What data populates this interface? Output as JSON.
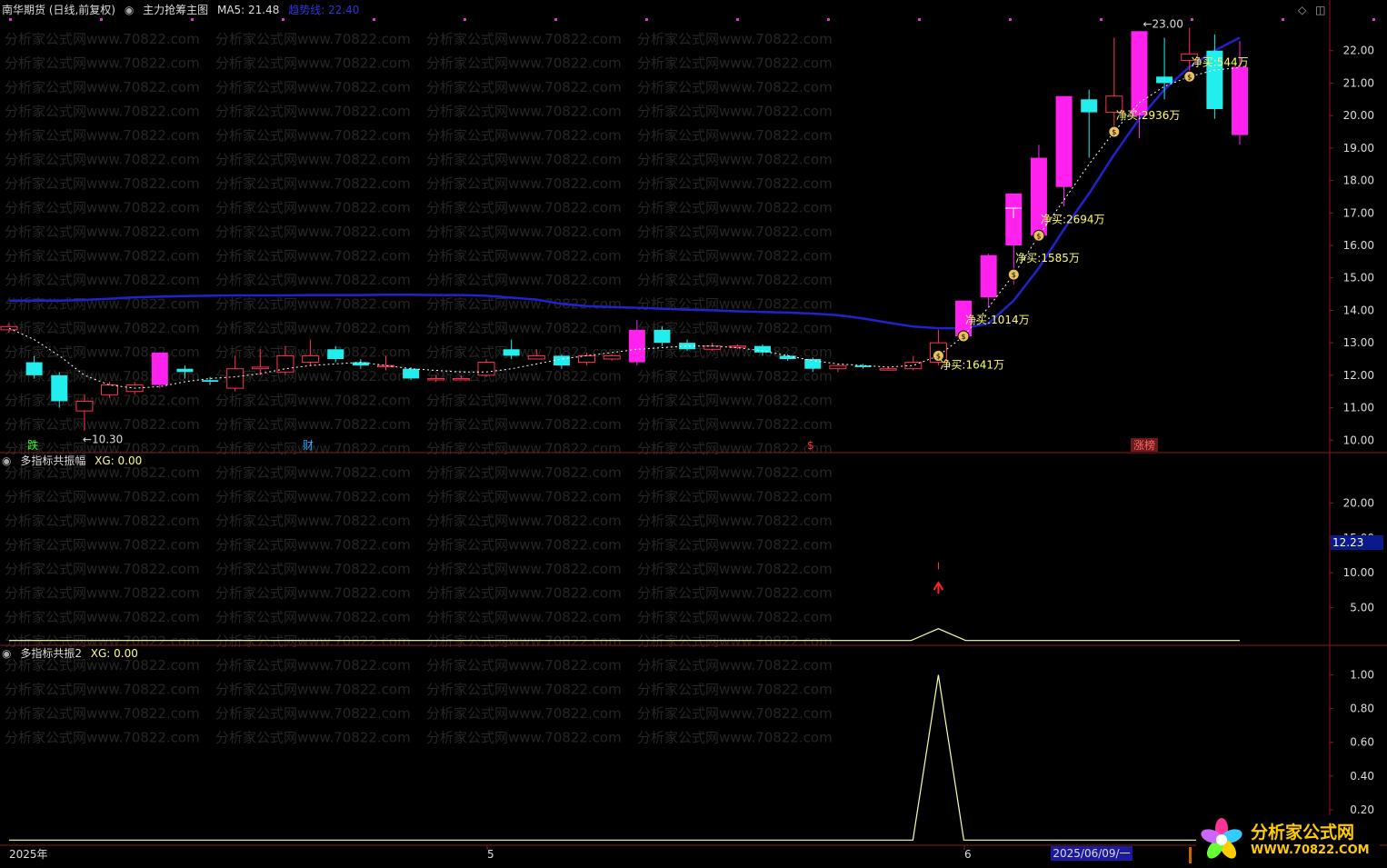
{
  "header1": {
    "symbol": "南华期货 (日线,前复权)",
    "indicator": "主力抢筹主图",
    "ma5_label": "MA5: 21.48",
    "trend_label": "趋势线: 22.40"
  },
  "header2": {
    "name": "多指标共振幅",
    "xg": "XG: 0.00"
  },
  "header3": {
    "name": "多指标共振2",
    "xg": "XG: 0.00"
  },
  "price_axis": [
    "22.00",
    "21.00",
    "20.00",
    "19.00",
    "18.00",
    "17.00",
    "16.00",
    "15.00",
    "14.00",
    "13.00",
    "12.00",
    "11.00",
    "10.00"
  ],
  "axis2": [
    "20.00",
    "15.00",
    "10.00",
    "5.00"
  ],
  "axis3": [
    "1.00",
    "0.80",
    "0.60",
    "0.40",
    "0.20"
  ],
  "axis2_value": "12.23",
  "date_axis": {
    "start": "2025年",
    "m5": "5",
    "m6": "6",
    "cursor": "2025/06/09/一"
  },
  "markers": {
    "m1": "跌",
    "m2": "财",
    "m3": "$",
    "m4": "涨榜"
  },
  "annotations": {
    "high": "23.00",
    "low": "←10.30",
    "buys": [
      "净买:1641万",
      "净买:1014万",
      "净买:1585万",
      "净买:2694万",
      "净买:2936万",
      "净买:544万"
    ]
  },
  "watermark": "分析家公式网www.70822.com",
  "logo": {
    "line1": "分析家公式网",
    "line2": "WWW.70822.COM"
  },
  "chart_data": {
    "type": "candlestick",
    "colors": {
      "up": "#ff3355",
      "down": "#22eeee",
      "strong_up": "#ff22ee",
      "ma": "#2222cc",
      "trend_dots": "#ffffff",
      "osc": "#ffffaa"
    },
    "candles": [
      [
        13.4,
        13.5,
        13.6,
        13.3
      ],
      [
        12.4,
        12.0,
        12.6,
        11.9
      ],
      [
        12.0,
        11.2,
        12.1,
        11.0
      ],
      [
        10.9,
        11.2,
        11.4,
        10.3
      ],
      [
        11.4,
        11.7,
        11.8,
        11.3
      ],
      [
        11.5,
        11.7,
        11.8,
        11.4
      ],
      [
        11.7,
        12.7,
        12.7,
        11.6
      ],
      [
        12.2,
        12.1,
        12.3,
        11.9
      ],
      [
        11.85,
        11.8,
        11.95,
        11.7
      ],
      [
        11.6,
        12.2,
        12.6,
        11.5
      ],
      [
        12.2,
        12.25,
        12.8,
        12.0
      ],
      [
        12.1,
        12.6,
        12.9,
        12.0
      ],
      [
        12.4,
        12.6,
        13.1,
        12.3
      ],
      [
        12.8,
        12.5,
        12.9,
        12.4
      ],
      [
        12.4,
        12.3,
        12.5,
        12.2
      ],
      [
        12.3,
        12.3,
        12.6,
        12.15
      ],
      [
        12.2,
        11.9,
        12.25,
        11.85
      ],
      [
        11.9,
        11.9,
        12.0,
        11.8
      ],
      [
        11.9,
        11.9,
        12.0,
        11.85
      ],
      [
        12.0,
        12.4,
        12.5,
        11.95
      ],
      [
        12.8,
        12.6,
        13.1,
        12.5
      ],
      [
        12.5,
        12.6,
        12.8,
        12.5
      ],
      [
        12.6,
        12.3,
        12.65,
        12.2
      ],
      [
        12.4,
        12.6,
        12.7,
        12.3
      ],
      [
        12.5,
        12.6,
        12.65,
        12.45
      ],
      [
        12.4,
        13.4,
        13.7,
        12.3
      ],
      [
        13.4,
        13.0,
        13.5,
        12.9
      ],
      [
        13.0,
        12.8,
        13.1,
        12.75
      ],
      [
        12.8,
        12.9,
        13.0,
        12.75
      ],
      [
        12.9,
        12.9,
        12.95,
        12.8
      ],
      [
        12.9,
        12.7,
        12.95,
        12.6
      ],
      [
        12.6,
        12.5,
        12.65,
        12.45
      ],
      [
        12.5,
        12.2,
        12.55,
        12.1
      ],
      [
        12.2,
        12.3,
        12.35,
        12.1
      ],
      [
        12.3,
        12.25,
        12.35,
        12.2
      ],
      [
        12.2,
        12.2,
        12.25,
        12.15
      ],
      [
        12.2,
        12.4,
        12.6,
        12.15
      ],
      [
        12.4,
        13.0,
        13.4,
        12.3
      ],
      [
        13.2,
        14.3,
        14.3,
        13.1
      ],
      [
        14.4,
        15.7,
        15.75,
        14.1
      ],
      [
        16.0,
        17.6,
        17.6,
        14.8
      ],
      [
        16.3,
        18.7,
        19.1,
        16.2
      ],
      [
        17.8,
        20.6,
        20.6,
        17.2
      ],
      [
        20.5,
        20.1,
        20.8,
        18.7
      ],
      [
        20.1,
        20.6,
        22.4,
        19.6
      ],
      [
        20.0,
        22.6,
        22.6,
        19.3
      ],
      [
        21.2,
        21.0,
        22.4,
        20.5
      ],
      [
        21.7,
        21.9,
        22.7,
        21.1
      ],
      [
        22.0,
        20.2,
        22.5,
        19.9
      ],
      [
        19.4,
        21.5,
        22.3,
        19.1
      ]
    ],
    "ma_line": [
      14.3,
      14.3,
      14.3,
      14.32,
      14.36,
      14.4,
      14.42,
      14.44,
      14.45,
      14.46,
      14.46,
      14.46,
      14.47,
      14.47,
      14.47,
      14.48,
      14.48,
      14.47,
      14.47,
      14.45,
      14.39,
      14.33,
      14.2,
      14.13,
      14.1,
      14.08,
      14.05,
      14.02,
      14.0,
      13.97,
      13.95,
      13.93,
      13.9,
      13.85,
      13.75,
      13.62,
      13.5,
      13.45,
      13.45,
      13.6,
      14.3,
      15.3,
      16.5,
      17.6,
      18.8,
      19.9,
      20.8,
      21.5,
      22.0,
      22.4
    ],
    "dots_line": [
      13.45,
      13.1,
      12.6,
      12.0,
      11.7,
      11.6,
      11.65,
      11.8,
      11.9,
      11.95,
      12.05,
      12.2,
      12.3,
      12.35,
      12.4,
      12.3,
      12.2,
      12.15,
      12.1,
      12.1,
      12.2,
      12.35,
      12.5,
      12.6,
      12.7,
      12.8,
      12.85,
      12.9,
      12.9,
      12.85,
      12.75,
      12.6,
      12.45,
      12.35,
      12.3,
      12.25,
      12.3,
      12.6,
      13.2,
      14.1,
      15.1,
      16.3,
      17.4,
      18.5,
      19.5,
      20.4,
      20.9,
      21.2,
      21.4,
      21.48
    ],
    "buy_at": [
      37,
      38,
      40,
      41,
      44,
      47
    ],
    "high_at": 45,
    "low_at": 3,
    "osc_peak_at": 37,
    "y_range_price": [
      9.7,
      23.0
    ],
    "y_range_p2": [
      0,
      25
    ],
    "y_range_p3": [
      0,
      1.1
    ]
  }
}
